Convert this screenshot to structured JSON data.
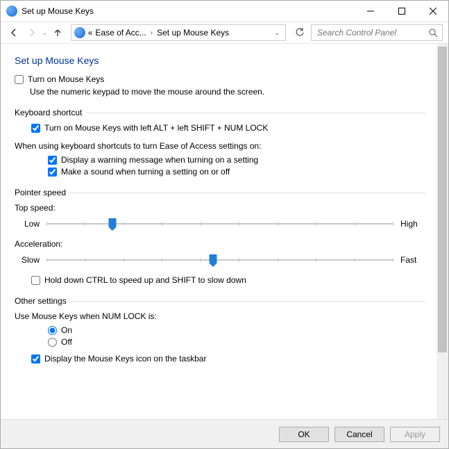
{
  "window": {
    "title": "Set up Mouse Keys"
  },
  "breadcrumb": {
    "root_prefix": "«",
    "item1": "Ease of Acc...",
    "item2": "Set up Mouse Keys"
  },
  "search": {
    "placeholder": "Search Control Panel"
  },
  "page": {
    "title": "Set up Mouse Keys",
    "turn_on": {
      "label": "Turn on Mouse Keys",
      "checked": false
    },
    "turn_on_desc": "Use the numeric keypad to move the mouse around the screen."
  },
  "shortcut": {
    "group_title": "Keyboard shortcut",
    "enable": {
      "label": "Turn on Mouse Keys with left ALT + left SHIFT + NUM LOCK",
      "checked": true
    },
    "when_using": "When using keyboard shortcuts to turn Ease of Access settings on:",
    "warn": {
      "label": "Display a warning message when turning on a setting",
      "checked": true
    },
    "sound": {
      "label": "Make a sound when turning a setting on or off",
      "checked": true
    }
  },
  "pointer": {
    "group_title": "Pointer speed",
    "top_speed": {
      "label": "Top speed:",
      "low": "Low",
      "high": "High",
      "value_pct": 19
    },
    "accel": {
      "label": "Acceleration:",
      "slow": "Slow",
      "fast": "Fast",
      "value_pct": 48
    },
    "ctrl_shift": {
      "label": "Hold down CTRL to speed up and SHIFT to slow down",
      "checked": false
    }
  },
  "other": {
    "group_title": "Other settings",
    "numlock_label": "Use Mouse Keys when NUM LOCK is:",
    "on": {
      "label": "On",
      "checked": true
    },
    "off": {
      "label": "Off",
      "checked": false
    },
    "taskbar": {
      "label": "Display the Mouse Keys icon on the taskbar",
      "checked": true
    }
  },
  "buttons": {
    "ok": "OK",
    "cancel": "Cancel",
    "apply": "Apply"
  }
}
